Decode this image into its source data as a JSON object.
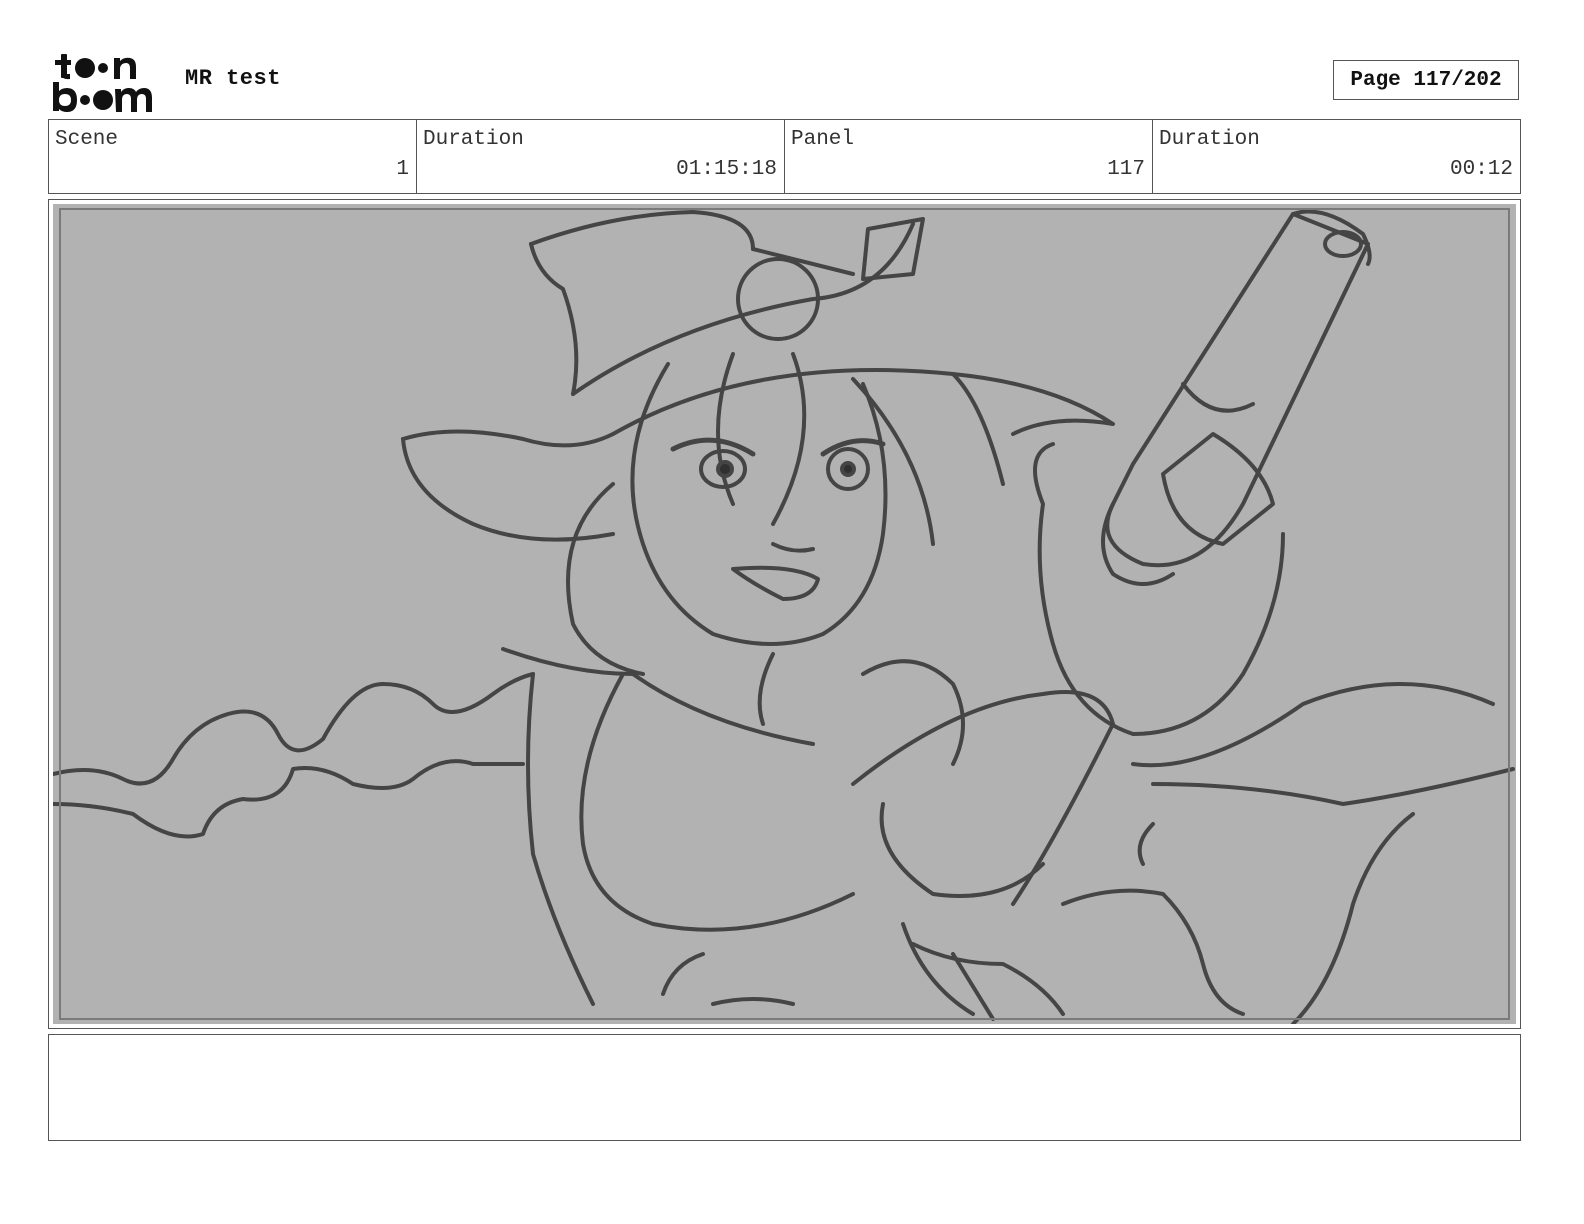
{
  "header": {
    "logo": {
      "text_line1": "toon",
      "text_line2": "boom",
      "icon": "toon-boom-logo"
    },
    "project_title": "MR test",
    "page_label": "Page 117/202"
  },
  "info": {
    "scene_label": "Scene",
    "scene_value": "1",
    "scene_duration_label": "Duration",
    "scene_duration_value": "01:15:18",
    "panel_label": "Panel",
    "panel_value": "117",
    "panel_duration_label": "Duration",
    "panel_duration_value": "00:12"
  },
  "panel": {
    "image": "storyboard-sketch",
    "background_color": "#b2b2b2"
  },
  "notes": {
    "text": ""
  }
}
